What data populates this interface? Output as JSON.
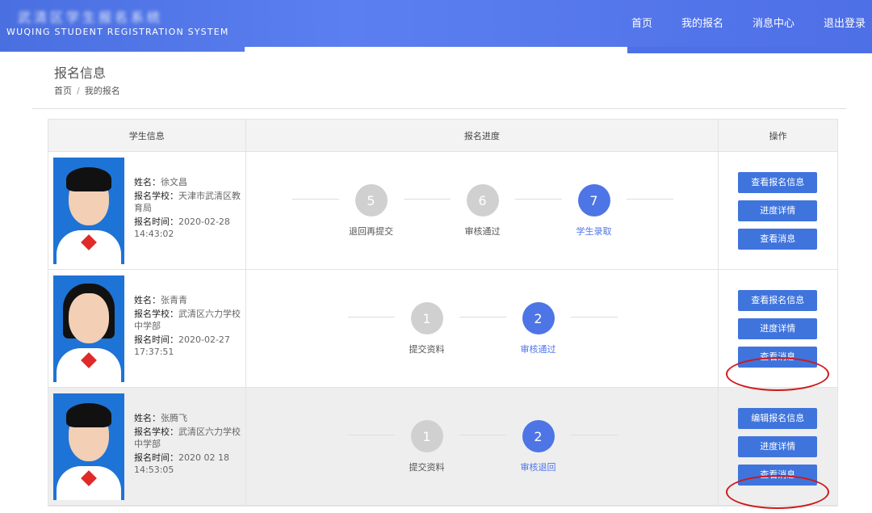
{
  "header": {
    "logo_text": "武清区学生报名系统",
    "system_name": "WUQING STUDENT REGISTRATION SYSTEM",
    "nav": [
      "首页",
      "我的报名",
      "消息中心",
      "退出登录"
    ]
  },
  "page": {
    "title": "报名信息",
    "breadcrumb": [
      "首页",
      "我的报名"
    ],
    "breadcrumb_sep": "/"
  },
  "table": {
    "headers": [
      "学生信息",
      "报名进度",
      "操作"
    ],
    "labels": {
      "name": "姓名：",
      "school": "报名学校：",
      "time": "报名时间："
    },
    "rows": [
      {
        "name": "徐文昌",
        "school": "天津市武清区教育局",
        "time": "2020-02-28 14:43:02",
        "steps": [
          {
            "num": "5",
            "label": "退回再提交",
            "active": false
          },
          {
            "num": "6",
            "label": "审核通过",
            "active": false
          },
          {
            "num": "7",
            "label": "学生录取",
            "active": true
          }
        ],
        "buttons": [
          "查看报名信息",
          "进度详情",
          "查看消息"
        ]
      },
      {
        "name": "张青青",
        "school": "武清区六力学校中学部",
        "time": "2020-02-27 17:37:51",
        "steps": [
          {
            "num": "1",
            "label": "提交资料",
            "active": false
          },
          {
            "num": "2",
            "label": "审核通过",
            "active": true
          }
        ],
        "buttons": [
          "查看报名信息",
          "进度详情",
          "查看消息"
        ]
      },
      {
        "name": "张腾飞",
        "school": "武清区六力学校中学部",
        "time": "2020 02 18 14:53:05",
        "steps": [
          {
            "num": "1",
            "label": "提交资料",
            "active": false
          },
          {
            "num": "2",
            "label": "审核退回",
            "active": true
          }
        ],
        "buttons": [
          "编辑报名信息",
          "进度详情",
          "查看消息"
        ]
      }
    ]
  },
  "colors": {
    "primary": "#3f74dd",
    "active_step": "#4e75e6",
    "inactive_step": "#d0d0d0",
    "annotation": "#d01818"
  }
}
